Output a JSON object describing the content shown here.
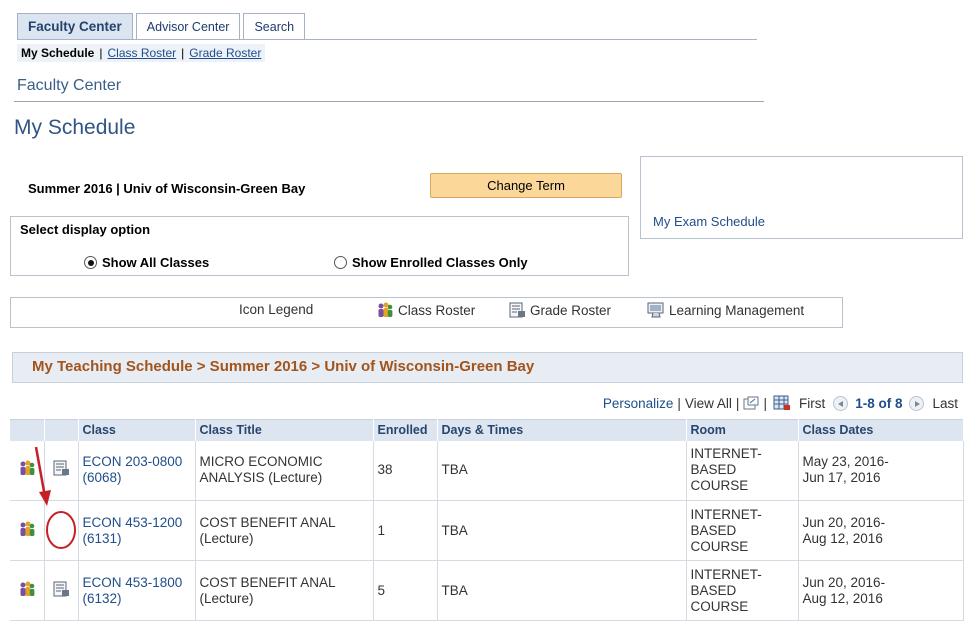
{
  "tabs": [
    {
      "label": "Faculty Center",
      "active": true
    },
    {
      "label": "Advisor Center",
      "active": false
    },
    {
      "label": "Search",
      "active": false
    }
  ],
  "subnav": {
    "current": "My Schedule",
    "links": [
      "Class Roster",
      "Grade Roster"
    ],
    "separator": "|"
  },
  "faculty_center_label": "Faculty Center",
  "page_title": "My Schedule",
  "term": "Summer 2016 | Univ of Wisconsin-Green Bay",
  "change_term_label": "Change Term",
  "exam_schedule_link": "My Exam Schedule",
  "display_option": {
    "label": "Select display option",
    "options": [
      {
        "label": "Show All Classes",
        "selected": true
      },
      {
        "label": "Show Enrolled Classes Only",
        "selected": false
      }
    ]
  },
  "legend": {
    "title": "Icon Legend",
    "items": [
      "Class Roster",
      "Grade Roster",
      "Learning Management"
    ]
  },
  "schedule_header": "My Teaching Schedule > Summer 2016 > Univ of Wisconsin-Green Bay",
  "grid_nav": {
    "personalize": "Personalize",
    "view_all": "View All",
    "first": "First",
    "range": "1-8 of 8",
    "last": "Last"
  },
  "table": {
    "columns": [
      "Class",
      "Class Title",
      "Enrolled",
      "Days & Times",
      "Room",
      "Class Dates"
    ],
    "rows": [
      {
        "class_code": "ECON 203-0800",
        "class_nbr": "(6068)",
        "title1": "MICRO ECONOMIC",
        "title2": "ANALYSIS (Lecture)",
        "enrolled": "38",
        "days": "TBA",
        "room1": "INTERNET-",
        "room2": "BASED",
        "room3": "COURSE",
        "date1": "May 23, 2016-",
        "date2": "Jun 17, 2016",
        "grade_icon": true
      },
      {
        "class_code": "ECON 453-1200",
        "class_nbr": "(6131)",
        "title1": "COST BENEFIT ANAL",
        "title2": "(Lecture)",
        "enrolled": "1",
        "days": "TBA",
        "room1": "INTERNET-",
        "room2": "BASED",
        "room3": "COURSE",
        "date1": "Jun 20, 2016-",
        "date2": "Aug 12, 2016",
        "grade_icon": false
      },
      {
        "class_code": "ECON 453-1800",
        "class_nbr": "(6132)",
        "title1": "COST BENEFIT ANAL",
        "title2": "(Lecture)",
        "enrolled": "5",
        "days": "TBA",
        "room1": "INTERNET-",
        "room2": "BASED",
        "room3": "COURSE",
        "date1": "Jun 20, 2016-",
        "date2": "Aug 12, 2016",
        "grade_icon": true
      }
    ]
  },
  "colors": {
    "accent_orange": "#a2541c",
    "link_blue": "#1f4e8a",
    "annotation_red": "#c62026"
  }
}
